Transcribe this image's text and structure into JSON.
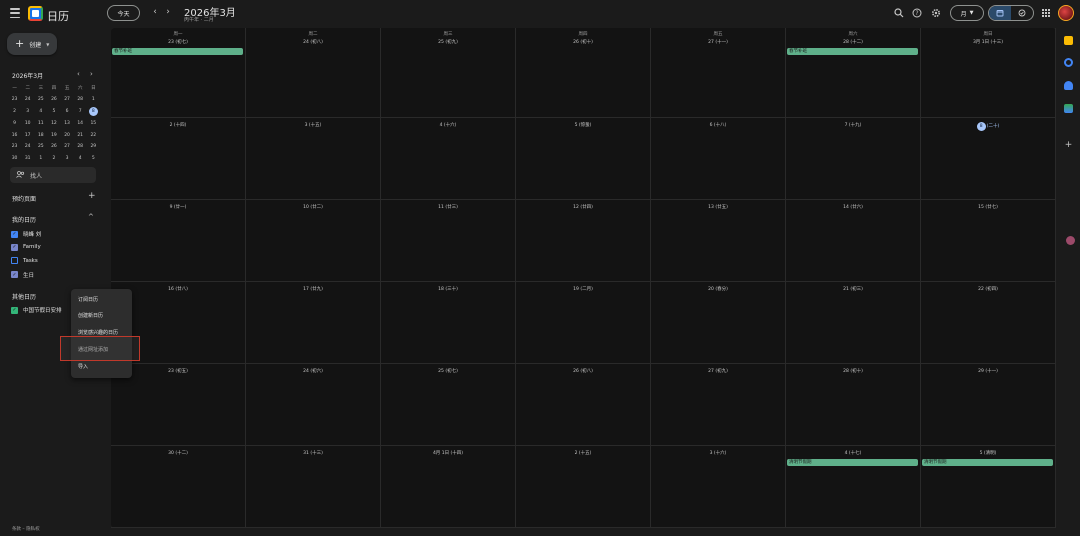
{
  "header": {
    "app_title": "日历",
    "today_label": "今天",
    "month_title": "2026年3月",
    "month_sub": "丙午年 · 二月",
    "view_label": "月",
    "prev_glyph": "‹",
    "next_glyph": "›"
  },
  "sidebar": {
    "create_label": "创建",
    "mini_month": "2026年3月",
    "weekdays": [
      "一",
      "二",
      "三",
      "四",
      "五",
      "六",
      "日"
    ],
    "mini_days": [
      "23",
      "24",
      "25",
      "26",
      "27",
      "28",
      "1",
      "2",
      "3",
      "4",
      "5",
      "6",
      "7",
      "8",
      "9",
      "10",
      "11",
      "12",
      "13",
      "14",
      "15",
      "16",
      "17",
      "18",
      "19",
      "20",
      "21",
      "22",
      "23",
      "24",
      "25",
      "26",
      "27",
      "28",
      "29",
      "30",
      "31",
      "1",
      "2",
      "3",
      "4",
      "5"
    ],
    "search_people": "找人",
    "booking_title": "预约页面",
    "my_cal_title": "我的日历",
    "my_cals": [
      {
        "label": "晓峰 刘",
        "color": "#4285f4",
        "checked": true
      },
      {
        "label": "Family",
        "color": "#7986cb",
        "checked": true
      },
      {
        "label": "Tasks",
        "color": "#4285f4",
        "checked": false
      },
      {
        "label": "生日",
        "color": "#7986cb",
        "checked": true
      }
    ],
    "other_cal_title": "其他日历",
    "other_cals": [
      {
        "label": "中国节假日安排",
        "color": "#33b679",
        "checked": true
      }
    ],
    "footer": "条款 – 隐私权"
  },
  "menu": {
    "items": [
      "订阅日历",
      "创建新日历",
      "浏览感兴趣的日历",
      "通过网址添加",
      "导入"
    ]
  },
  "calendar": {
    "weekdays": [
      "周一",
      "周二",
      "周三",
      "周四",
      "周五",
      "周六",
      "周日"
    ],
    "weeks": [
      [
        "23 (初七)",
        "24 (初八)",
        "25 (初九)",
        "26 (初十)",
        "27 (十一)",
        "28 (十二)",
        "3月 1日 (十三)"
      ],
      [
        "2 (十四)",
        "3 (十五)",
        "4 (十六)",
        "5 (惊蛰)",
        "6 (十八)",
        "7 (十九)",
        "8 (二十)"
      ],
      [
        "9 (廿一)",
        "10 (廿二)",
        "11 (廿三)",
        "12 (廿四)",
        "13 (廿五)",
        "14 (廿六)",
        "15 (廿七)"
      ],
      [
        "16 (廿八)",
        "17 (廿九)",
        "18 (三十)",
        "19 (二月)",
        "20 (春分)",
        "21 (初三)",
        "22 (初四)"
      ],
      [
        "23 (初五)",
        "24 (初六)",
        "25 (初七)",
        "26 (初八)",
        "27 (初九)",
        "28 (初十)",
        "29 (十一)"
      ],
      [
        "30 (十二)",
        "31 (十三)",
        "4月 1日 (十四)",
        "2 (十五)",
        "3 (十六)",
        "4 (十七)",
        "5 (清明)"
      ]
    ],
    "today_day": "8",
    "today_suffix": "(二十)",
    "events": [
      {
        "label": "春节补班",
        "week": 0,
        "day": 0
      },
      {
        "label": "春节补班",
        "week": 0,
        "day": 5
      },
      {
        "label": "清明节假期",
        "week": 5,
        "day": 5
      },
      {
        "label": "清明节假期",
        "week": 5,
        "day": 6
      }
    ]
  },
  "colors": {
    "event_green": "#5fb08a",
    "accent_blue": "#a8c7fa"
  }
}
